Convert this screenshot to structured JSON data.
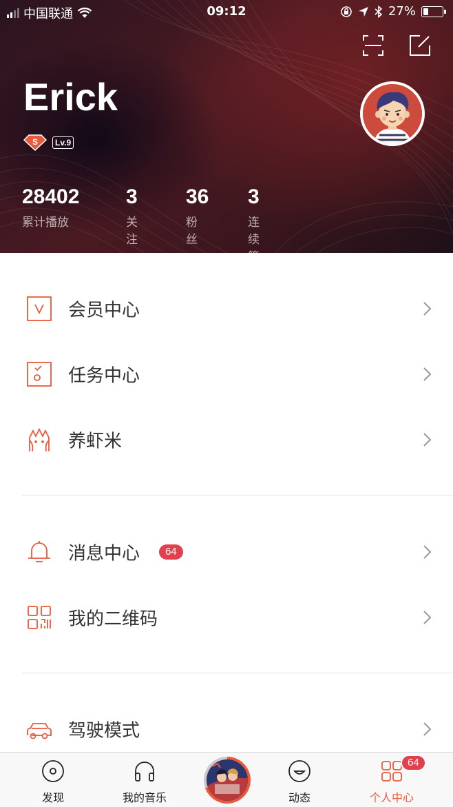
{
  "status_bar": {
    "carrier": "中国联通",
    "time": "09:12",
    "battery": "27%"
  },
  "header": {
    "username": "Erick",
    "member_badge": "S",
    "level": "Lv.9",
    "stats": [
      {
        "value": "28402",
        "label": "累计播放"
      },
      {
        "value": "3",
        "label": "关注"
      },
      {
        "value": "36",
        "label": "粉丝"
      },
      {
        "value": "3",
        "label": "连续签到"
      }
    ]
  },
  "menu": {
    "group1": [
      {
        "label": "会员中心",
        "icon": "vip-icon"
      },
      {
        "label": "任务中心",
        "icon": "task-icon"
      },
      {
        "label": "养虾米",
        "icon": "shrimp-icon"
      }
    ],
    "group2": [
      {
        "label": "消息中心",
        "icon": "bell-icon",
        "badge": "64"
      },
      {
        "label": "我的二维码",
        "icon": "qrcode-icon"
      }
    ],
    "group3": [
      {
        "label": "驾驶模式",
        "icon": "car-icon"
      }
    ]
  },
  "tabbar": {
    "tabs": [
      {
        "label": "发现",
        "icon": "disc-icon"
      },
      {
        "label": "我的音乐",
        "icon": "headphones-icon"
      },
      {
        "label": "动态",
        "icon": "smile-icon"
      },
      {
        "label": "个人中心",
        "icon": "grid-icon",
        "active": true
      }
    ],
    "badge": "64"
  },
  "colors": {
    "accent": "#e85a3c",
    "badge_red": "#e2404f",
    "header_dark": "#2a1420"
  }
}
